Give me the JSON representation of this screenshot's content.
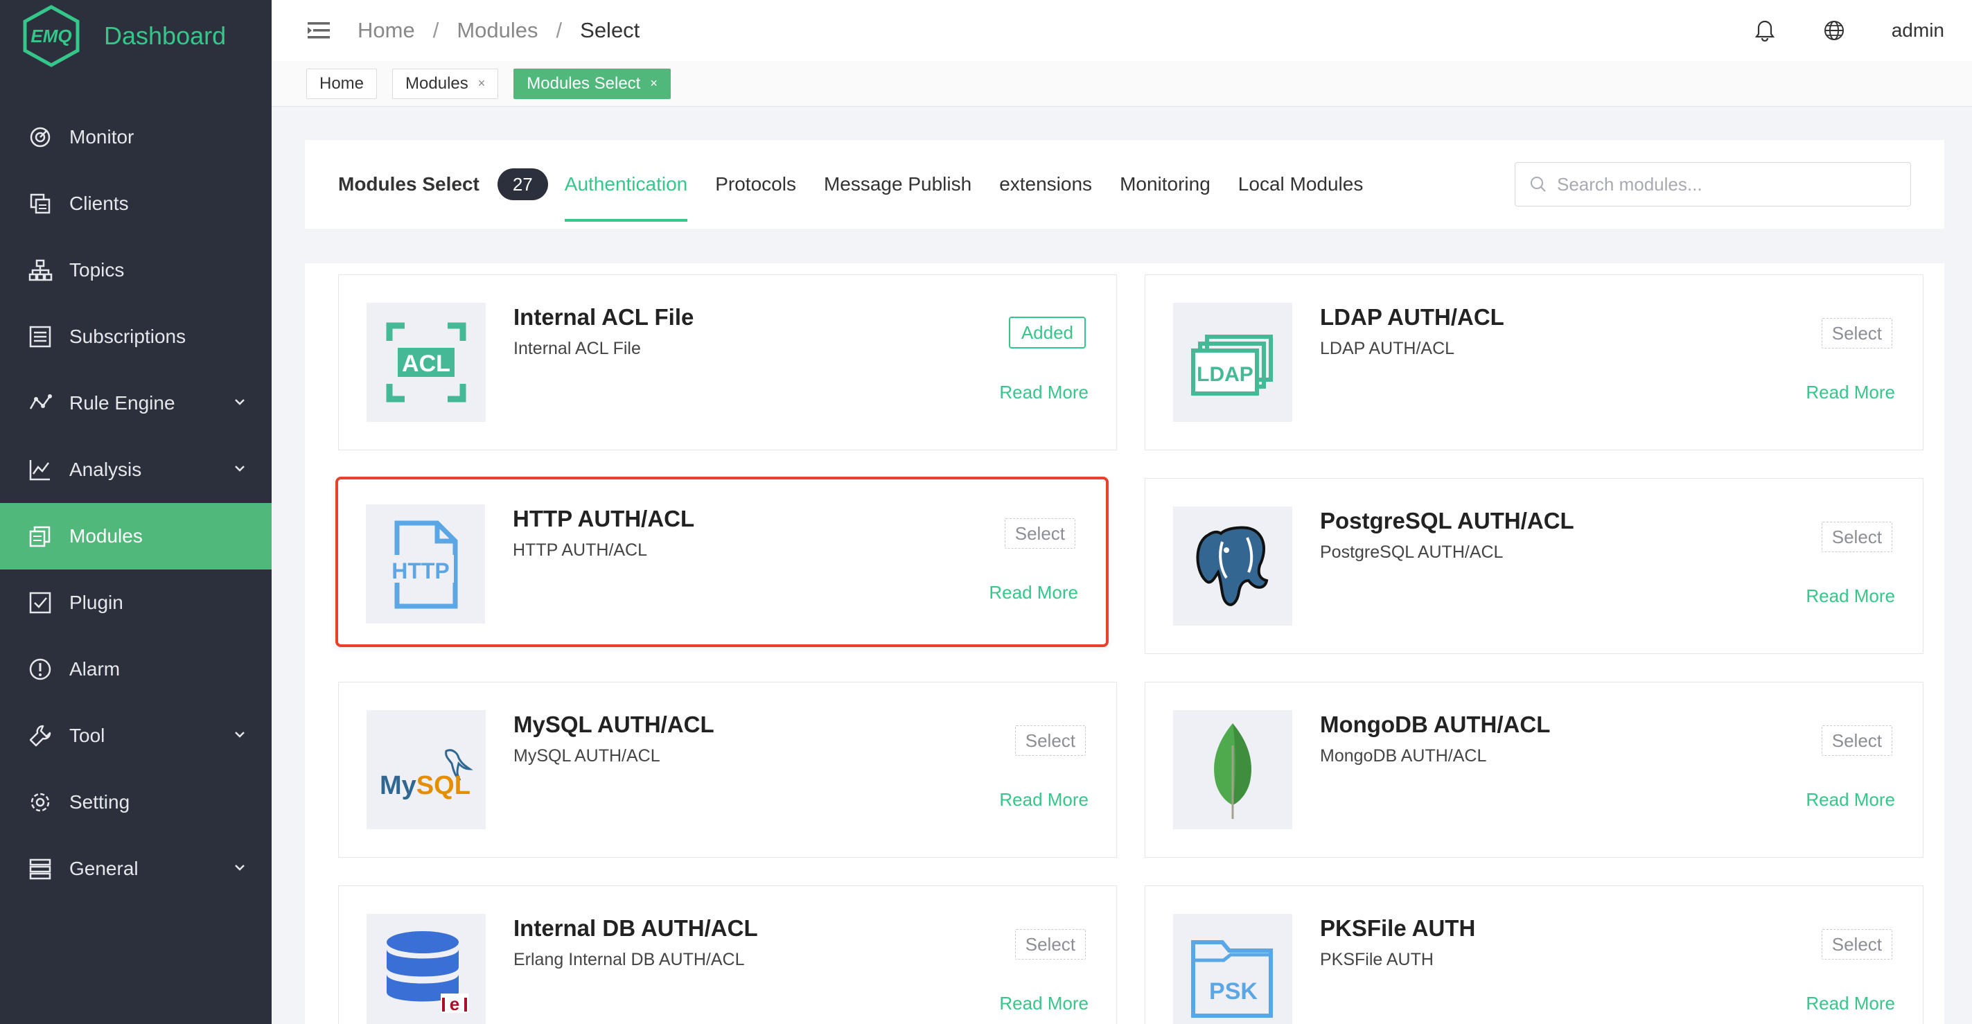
{
  "brand": {
    "logo_text": "EMQ",
    "title": "Dashboard"
  },
  "sidebar": {
    "items": [
      {
        "label": "Monitor",
        "icon": "monitor-icon",
        "expandable": false
      },
      {
        "label": "Clients",
        "icon": "clients-icon",
        "expandable": false
      },
      {
        "label": "Topics",
        "icon": "topics-icon",
        "expandable": false
      },
      {
        "label": "Subscriptions",
        "icon": "subscriptions-icon",
        "expandable": false
      },
      {
        "label": "Rule Engine",
        "icon": "rule-engine-icon",
        "expandable": true
      },
      {
        "label": "Analysis",
        "icon": "analysis-icon",
        "expandable": true
      },
      {
        "label": "Modules",
        "icon": "modules-icon",
        "expandable": false,
        "active": true
      },
      {
        "label": "Plugin",
        "icon": "plugin-icon",
        "expandable": false
      },
      {
        "label": "Alarm",
        "icon": "alarm-icon",
        "expandable": false
      },
      {
        "label": "Tool",
        "icon": "tool-icon",
        "expandable": true
      },
      {
        "label": "Setting",
        "icon": "setting-icon",
        "expandable": false
      },
      {
        "label": "General",
        "icon": "general-icon",
        "expandable": true
      }
    ]
  },
  "header": {
    "breadcrumb": [
      "Home",
      "Modules",
      "Select"
    ],
    "separator": "/",
    "user": "admin",
    "icons": [
      "menu-toggle-icon",
      "bell-icon",
      "globe-icon"
    ]
  },
  "tags": [
    {
      "label": "Home",
      "closable": false,
      "active": false
    },
    {
      "label": "Modules",
      "closable": true,
      "active": false
    },
    {
      "label": "Modules Select",
      "closable": true,
      "active": true
    }
  ],
  "tag_close": "×",
  "filter": {
    "title": "Modules Select",
    "count": "27",
    "tabs": [
      "Authentication",
      "Protocols",
      "Message Publish",
      "extensions",
      "Monitoring",
      "Local Modules"
    ],
    "active_tab": "Authentication",
    "search_placeholder": "Search modules..."
  },
  "modules": [
    {
      "name": "Internal ACL File",
      "desc": "Internal ACL File",
      "button": "Added",
      "state": "added",
      "link": "Read More",
      "logo": "acl-logo",
      "logo_text": "ACL"
    },
    {
      "name": "LDAP AUTH/ACL",
      "desc": "LDAP AUTH/ACL",
      "button": "Select",
      "state": "select",
      "link": "Read More",
      "logo": "ldap-logo",
      "logo_text": "LDAP"
    },
    {
      "name": "HTTP AUTH/ACL",
      "desc": "HTTP AUTH/ACL",
      "button": "Select",
      "state": "select",
      "link": "Read More",
      "logo": "http-logo",
      "logo_text": "HTTP",
      "highlighted": true
    },
    {
      "name": "PostgreSQL AUTH/ACL",
      "desc": "PostgreSQL AUTH/ACL",
      "button": "Select",
      "state": "select",
      "link": "Read More",
      "logo": "postgresql-logo"
    },
    {
      "name": "MySQL AUTH/ACL",
      "desc": "MySQL AUTH/ACL",
      "button": "Select",
      "state": "select",
      "link": "Read More",
      "logo": "mysql-logo",
      "logo_text": "MySQL"
    },
    {
      "name": "MongoDB AUTH/ACL",
      "desc": "MongoDB AUTH/ACL",
      "button": "Select",
      "state": "select",
      "link": "Read More",
      "logo": "mongodb-logo"
    },
    {
      "name": "Internal DB AUTH/ACL",
      "desc": "Erlang Internal DB AUTH/ACL",
      "button": "Select",
      "state": "select",
      "link": "Read More",
      "logo": "internal-db-logo"
    },
    {
      "name": "PKSFile AUTH",
      "desc": "PKSFile AUTH",
      "button": "Select",
      "state": "select",
      "link": "Read More",
      "logo": "pksfile-logo",
      "logo_text": "PSK"
    }
  ],
  "colors": {
    "accent": "#35c78a",
    "sidebar_bg": "#2c303c",
    "active_menu": "#51b87c",
    "highlight_border": "#e8402c"
  }
}
